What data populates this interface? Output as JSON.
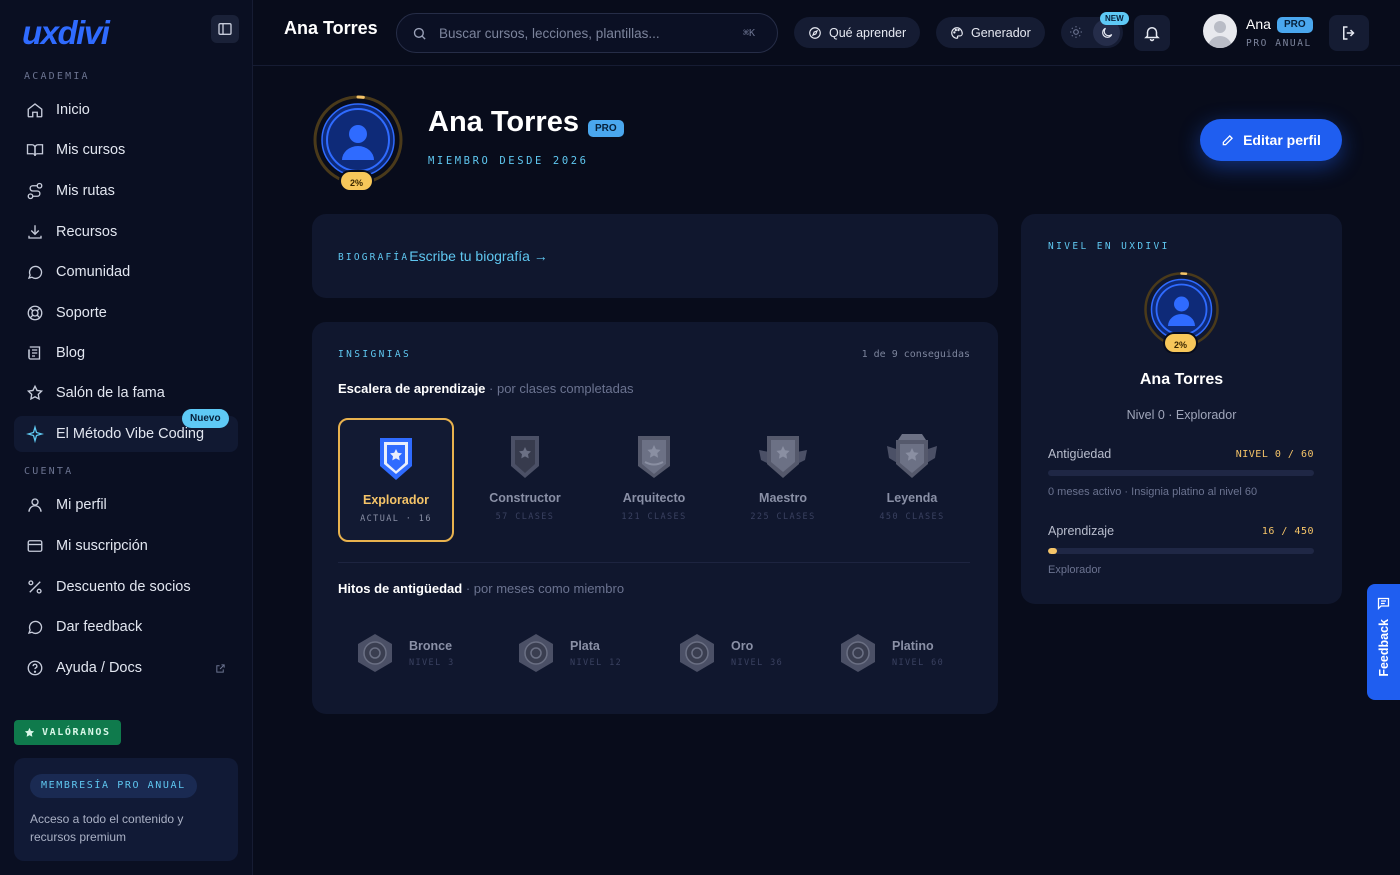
{
  "brand": {
    "logo": "uxdivi"
  },
  "sidebar": {
    "section_academy": "ACADEMIA",
    "section_account": "CUENTA",
    "items": [
      {
        "label": "Inicio"
      },
      {
        "label": "Mis cursos"
      },
      {
        "label": "Mis rutas"
      },
      {
        "label": "Recursos"
      },
      {
        "label": "Comunidad"
      },
      {
        "label": "Soporte"
      },
      {
        "label": "Blog"
      },
      {
        "label": "Salón de la fama"
      },
      {
        "label": "El Método Vibe Coding",
        "badge": "Nuevo"
      }
    ],
    "account_items": [
      {
        "label": "Mi perfil"
      },
      {
        "label": "Mi suscripción"
      },
      {
        "label": "Descuento de socios"
      },
      {
        "label": "Dar feedback"
      },
      {
        "label": "Ayuda / Docs"
      }
    ],
    "rate_label": "VALÓRANOS",
    "membership": {
      "pill": "MEMBRESÍA PRO ANUAL",
      "desc": "Acceso a todo el contenido y recursos premium"
    }
  },
  "topbar": {
    "title": "Ana Torres",
    "search_placeholder": "Buscar cursos, lecciones, plantillas...",
    "search_kbd": "⌘K",
    "what_to_learn": "Qué aprender",
    "generator": "Generador",
    "new_tag": "NEW",
    "user": {
      "name": "Ana",
      "badge": "PRO",
      "plan": "PRO ANUAL"
    }
  },
  "profile": {
    "name": "Ana Torres",
    "badge": "PRO",
    "member_since": "MIEMBRO DESDE 2026",
    "progress_label": "2%",
    "progress": 0.02,
    "edit_label": "Editar perfil"
  },
  "bio": {
    "label": "BIOGRAFÍA",
    "link": "Escribe tu biografía →"
  },
  "badges": {
    "label": "INSIGNIAS",
    "count": "1 de 9 conseguidas",
    "ladder_title": "Escalera de aprendizaje",
    "ladder_subtitle": " · por clases completadas",
    "ladder": [
      {
        "name": "Explorador",
        "sub": "ACTUAL · 16"
      },
      {
        "name": "Constructor",
        "sub": "57 CLASES"
      },
      {
        "name": "Arquitecto",
        "sub": "121 CLASES"
      },
      {
        "name": "Maestro",
        "sub": "225 CLASES"
      },
      {
        "name": "Leyenda",
        "sub": "450 CLASES"
      }
    ],
    "milestones_title": "Hitos de antigüedad",
    "milestones_subtitle": " · por meses como miembro",
    "milestones": [
      {
        "name": "Bronce",
        "sub": "NIVEL 3"
      },
      {
        "name": "Plata",
        "sub": "NIVEL 12"
      },
      {
        "name": "Oro",
        "sub": "NIVEL 36"
      },
      {
        "name": "Platino",
        "sub": "NIVEL 60"
      }
    ]
  },
  "level": {
    "label": "NIVEL EN UXDIVI",
    "progress_label": "2%",
    "name": "Ana Torres",
    "sub": "Nivel 0 · Explorador",
    "seniority_label": "Antigüedad",
    "seniority_value": "NIVEL 0 / 60",
    "seniority_progress": 0,
    "seniority_note": "0 meses activo · Insignia platino al nivel 60",
    "learning_label": "Aprendizaje",
    "learning_value": "16 / 450",
    "learning_progress": 0.0356,
    "learning_note": "Explorador"
  },
  "feedback": {
    "label": "Feedback"
  },
  "colors": {
    "accent": "#1f5ef0",
    "cyan": "#5fc7f0",
    "gold": "#f5c468",
    "bg": "#080c1b"
  }
}
